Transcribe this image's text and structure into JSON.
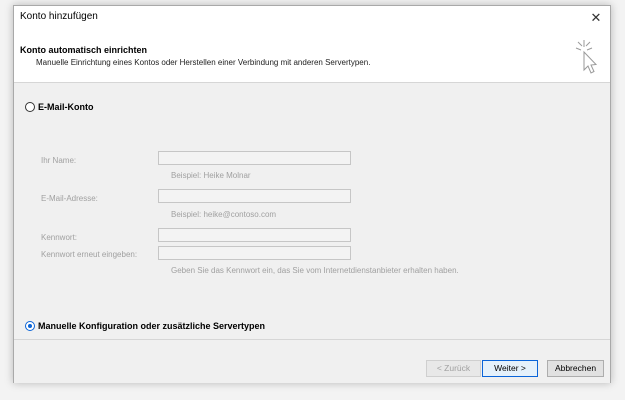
{
  "window": {
    "title": "Konto hinzufügen",
    "close_glyph": "✕"
  },
  "header": {
    "title": "Konto automatisch einrichten",
    "subtitle": "Manuelle Einrichtung eines Kontos oder Herstellen einer Verbindung mit anderen Servertypen.",
    "icon": "cursor-click-icon"
  },
  "email_option": {
    "label": "E-Mail-Konto",
    "selected": false
  },
  "form": {
    "name_label": "Ihr Name:",
    "name_value": "",
    "name_hint": "Beispiel: Heike Molnar",
    "email_label": "E-Mail-Adresse:",
    "email_value": "",
    "email_hint": "Beispiel: heike@contoso.com",
    "password_label": "Kennwort:",
    "password_value": "",
    "password_repeat_label": "Kennwort erneut eingeben:",
    "password_repeat_value": "",
    "password_hint": "Geben Sie das Kennwort ein, das Sie vom Internetdienstanbieter erhalten haben."
  },
  "manual_option": {
    "label": "Manuelle Konfiguration oder zusätzliche Servertypen",
    "selected": true
  },
  "footer": {
    "back_label": "< Zurück",
    "next_label": "Weiter >",
    "cancel_label": "Abbrechen"
  },
  "colors": {
    "accent": "#0a64d8",
    "disabled_text": "#a0a0a0"
  }
}
